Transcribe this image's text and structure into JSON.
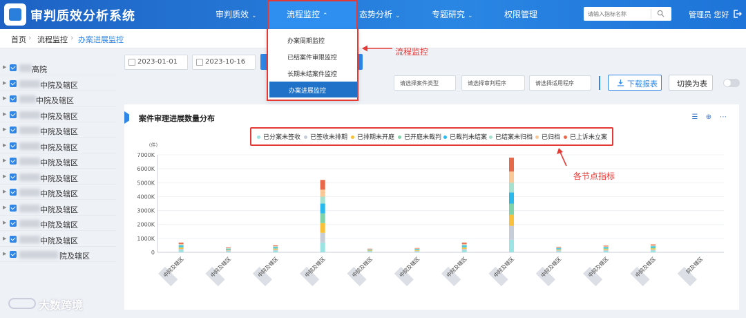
{
  "app": {
    "title": "审判质效分析系统"
  },
  "nav": {
    "items": [
      {
        "label": "审判质效",
        "chevron": true
      },
      {
        "label": "流程监控",
        "chevron": true
      },
      {
        "label": "态势分析",
        "chevron": true
      },
      {
        "label": "专题研究",
        "chevron": true
      },
      {
        "label": "权限管理",
        "chevron": false
      }
    ],
    "active_index": 1
  },
  "search": {
    "placeholder": "请输入指标名称"
  },
  "user": {
    "text": "管理员 您好"
  },
  "breadcrumb": [
    "首页",
    "流程监控",
    "办案进展监控"
  ],
  "dropdown": {
    "items": [
      "办案周期监控",
      "已结案件审限监控",
      "长期未结案件监控",
      "办案进展监控"
    ],
    "active_index": 3
  },
  "annotations": {
    "menu": "流程监控",
    "legend": "各节点指标"
  },
  "sidebar": {
    "items": [
      {
        "suffix": "高院"
      },
      {
        "suffix": "中院及辖区"
      },
      {
        "suffix": "中院及辖区"
      },
      {
        "suffix": "中院及辖区"
      },
      {
        "suffix": "中院及辖区"
      },
      {
        "suffix": "中院及辖区"
      },
      {
        "suffix": "中院及辖区"
      },
      {
        "suffix": "中院及辖区"
      },
      {
        "suffix": "中院及辖区"
      },
      {
        "suffix": "中院及辖区"
      },
      {
        "suffix": "中院及辖区"
      },
      {
        "suffix": "中院及辖区"
      },
      {
        "suffix": "院及辖区"
      }
    ]
  },
  "filters": {
    "start_date": "2023-01-01",
    "end_date": "2023-10-16",
    "case_type_placeholder": "请选择案件类型",
    "trial_procedure_placeholder": "请选择审判程序",
    "applicable_procedure_placeholder": "请选择适用程序",
    "download_label": "下载报表",
    "switch_label": "切换为表"
  },
  "chart_panel": {
    "title": "案件审理进展数量分布"
  },
  "colors": {
    "primary": "#2f86e6",
    "header": "#1e6fd1",
    "annotation": "#e53935"
  },
  "chart_data": {
    "type": "bar",
    "stacked": true,
    "unit_label": "(件)",
    "ylim": [
      0,
      7000
    ],
    "y_ticks": [
      "0",
      "1000K",
      "2000K",
      "3000K",
      "4000K",
      "5000K",
      "6000K",
      "7000K"
    ],
    "categories": [
      "中院及辖区",
      "中院及辖区",
      "中院及辖区",
      "中院及辖区",
      "中院及辖区",
      "中院及辖区",
      "中院及辖区",
      "中院及辖区",
      "中院及辖区",
      "中院及辖区",
      "中院及辖区",
      "院及辖区"
    ],
    "series": [
      {
        "name": "已分案未签收",
        "color": "#9ce3e3",
        "values": [
          150,
          80,
          120,
          700,
          60,
          60,
          150,
          900,
          80,
          100,
          120,
          20
        ]
      },
      {
        "name": "已签收未排期",
        "color": "#c7cdd8",
        "values": [
          100,
          60,
          80,
          700,
          40,
          50,
          100,
          1000,
          60,
          80,
          90,
          10
        ]
      },
      {
        "name": "已排期未开庭",
        "color": "#f9c13a",
        "values": [
          80,
          40,
          60,
          700,
          30,
          40,
          80,
          800,
          50,
          60,
          70,
          0
        ]
      },
      {
        "name": "已开庭未裁判",
        "color": "#7fd3a8",
        "values": [
          80,
          40,
          60,
          700,
          30,
          40,
          80,
          800,
          50,
          60,
          70,
          0
        ]
      },
      {
        "name": "已裁判未结案",
        "color": "#29b9ec",
        "values": [
          80,
          40,
          60,
          700,
          30,
          40,
          80,
          800,
          50,
          60,
          70,
          0
        ]
      },
      {
        "name": "已结案未归档",
        "color": "#a6e0cf",
        "values": [
          60,
          30,
          40,
          500,
          20,
          30,
          60,
          700,
          40,
          40,
          50,
          0
        ]
      },
      {
        "name": "已归档",
        "color": "#f9c896",
        "values": [
          50,
          30,
          30,
          500,
          20,
          20,
          50,
          800,
          30,
          30,
          40,
          0
        ]
      },
      {
        "name": "已上诉未立案",
        "color": "#e8694a",
        "values": [
          100,
          40,
          50,
          700,
          30,
          30,
          100,
          1000,
          40,
          50,
          60,
          0
        ]
      }
    ]
  }
}
